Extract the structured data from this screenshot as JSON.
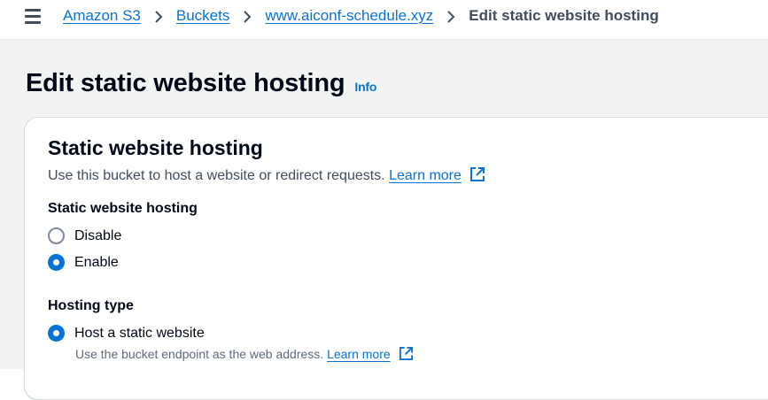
{
  "breadcrumb": {
    "items": [
      "Amazon S3",
      "Buckets",
      "www.aiconf-schedule.xyz"
    ],
    "current": "Edit static website hosting"
  },
  "page": {
    "title": "Edit static website hosting",
    "info_label": "Info"
  },
  "panel": {
    "title": "Static website hosting",
    "description": "Use this bucket to host a website or redirect requests.",
    "learn_more": "Learn more",
    "hosting_field": {
      "label": "Static website hosting",
      "options": [
        {
          "label": "Disable",
          "selected": false
        },
        {
          "label": "Enable",
          "selected": true
        }
      ]
    },
    "hosting_type_field": {
      "label": "Hosting type",
      "options": [
        {
          "label": "Host a static website",
          "selected": true,
          "description": "Use the bucket endpoint as the web address.",
          "learn_more": "Learn more"
        }
      ]
    }
  },
  "icons": [
    "menu-icon",
    "chevron-right-icon",
    "external-link-icon"
  ],
  "colors": {
    "link": "#0972d3",
    "radio_selected": "#0972d3",
    "background": "#f2f3f3",
    "panel": "#ffffff"
  }
}
